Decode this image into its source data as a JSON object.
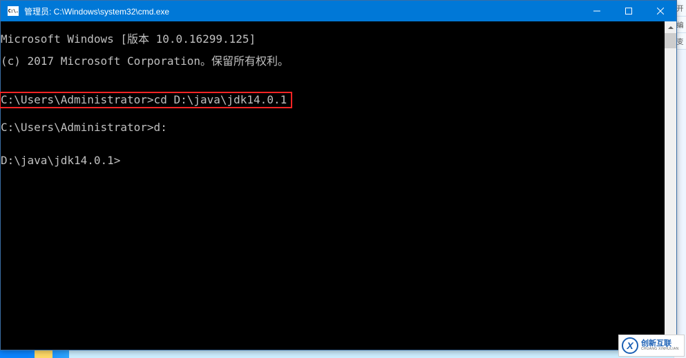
{
  "window": {
    "title": "管理员: C:\\Windows\\system32\\cmd.exe",
    "icon_label": "C:\\."
  },
  "terminal": {
    "line1": "Microsoft Windows [版本 10.0.16299.125]",
    "line2": "(c) 2017 Microsoft Corporation。保留所有权利。",
    "blank1": "",
    "prompt1_full": "C:\\Users\\Administrator>cd D:\\java\\jdk14.0.1",
    "blank2": "",
    "prompt2_full": "C:\\Users\\Administrator>d:",
    "blank3": "",
    "prompt3_full": "D:\\java\\jdk14.0.1>"
  },
  "sidebar_tabs": [
    "开",
    "编",
    "变"
  ],
  "watermark": {
    "logo_letter": "X",
    "cn": "创新互联",
    "en": "CHUANG XINHULIAN"
  }
}
